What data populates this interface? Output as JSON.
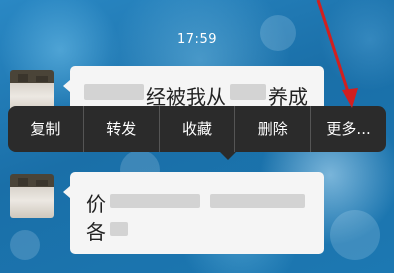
{
  "status": {
    "time": "17:59"
  },
  "messages": [
    {
      "sender": "contact",
      "text_visible_end": "经被我从",
      "text_tail": "养成"
    },
    {
      "sender": "contact",
      "line1_start": "价",
      "line2_start": "各"
    }
  ],
  "context_menu": {
    "items": [
      {
        "label": "复制"
      },
      {
        "label": "转发"
      },
      {
        "label": "收藏"
      },
      {
        "label": "删除"
      },
      {
        "label": "更多..."
      }
    ]
  },
  "colors": {
    "menu_bg": "#2b2b2b",
    "bubble_bg": "#f5f5f5",
    "annotation_arrow": "#d21f1f"
  }
}
